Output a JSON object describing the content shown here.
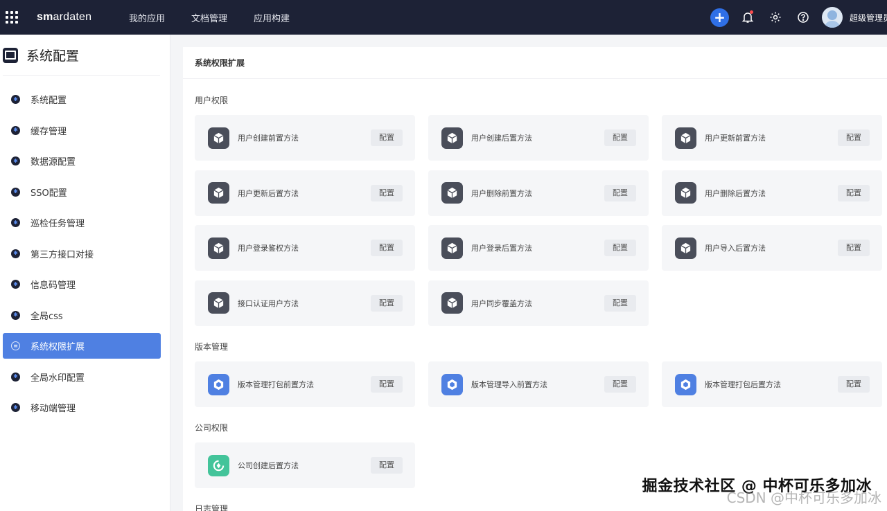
{
  "topbar": {
    "logo_prefix": "sm",
    "logo_rest": "ardaten",
    "nav": [
      "我的应用",
      "文档管理",
      "应用构建"
    ],
    "add_label": "+",
    "username": "超级管理员"
  },
  "sidebar": {
    "title": "系统配置",
    "items": [
      {
        "label": "系统配置"
      },
      {
        "label": "缓存管理"
      },
      {
        "label": "数据源配置"
      },
      {
        "label": "SSO配置"
      },
      {
        "label": "巡检任务管理"
      },
      {
        "label": "第三方接口对接"
      },
      {
        "label": "信息码管理"
      },
      {
        "label": "全局css"
      },
      {
        "label": "系统权限扩展",
        "active": true
      },
      {
        "label": "全局水印配置"
      },
      {
        "label": "移动端管理"
      }
    ]
  },
  "main": {
    "title": "系统权限扩展",
    "config_label": "配置",
    "sections": [
      {
        "title": "用户权限",
        "icon_style": "dark",
        "cards": [
          "用户创建前置方法",
          "用户创建后置方法",
          "用户更新前置方法",
          "用户更新后置方法",
          "用户删除前置方法",
          "用户删除后置方法",
          "用户登录鉴权方法",
          "用户登录后置方法",
          "用户导入后置方法",
          "接口认证用户方法",
          "用户同步覆盖方法"
        ]
      },
      {
        "title": "版本管理",
        "icon_style": "blue",
        "cards": [
          "版本管理打包前置方法",
          "版本管理导入前置方法",
          "版本管理打包后置方法"
        ]
      },
      {
        "title": "公司权限",
        "icon_style": "green",
        "cards": [
          "公司创建后置方法"
        ]
      },
      {
        "title": "日志管理",
        "icon_style": "dark",
        "cards": []
      }
    ]
  },
  "watermark": {
    "main": "掘金技术社区 @ 中杯可乐多加冰",
    "secondary": "CSDN @中杯可乐多加冰"
  },
  "colors": {
    "topbar_bg": "#1d2236",
    "accent": "#4f80e2",
    "plus_button": "#2f6fe6",
    "green_icon": "#43c49a"
  }
}
